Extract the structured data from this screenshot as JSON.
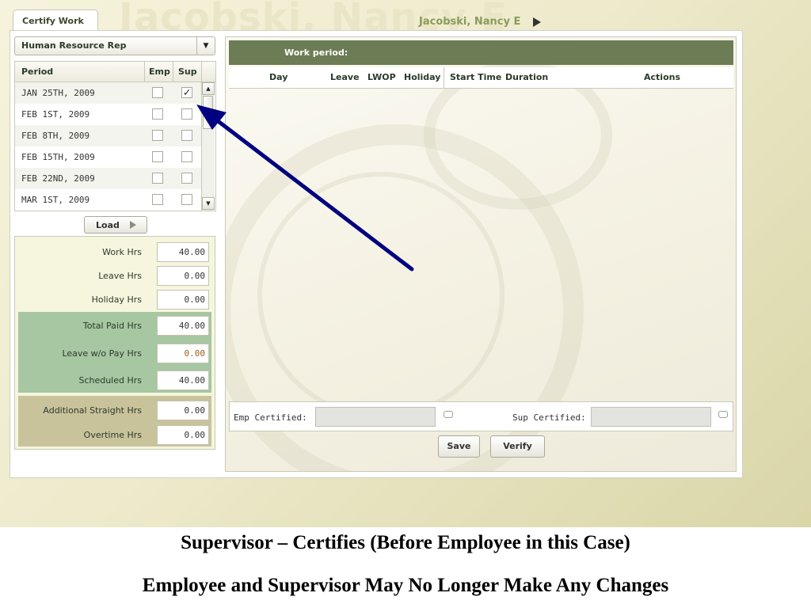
{
  "background_name": "Jacobski, Nancy E",
  "tab": {
    "label": "Certify Work"
  },
  "user": {
    "name": "Jacobski, Nancy E"
  },
  "role_select": {
    "value": "Human Resource Rep"
  },
  "period_grid": {
    "headers": {
      "period": "Period",
      "emp": "Emp",
      "sup": "Sup"
    },
    "rows": [
      {
        "period": "JAN 25TH, 2009",
        "emp": false,
        "sup": true
      },
      {
        "period": "FEB 1ST, 2009",
        "emp": false,
        "sup": false
      },
      {
        "period": "FEB 8TH, 2009",
        "emp": false,
        "sup": false
      },
      {
        "period": "FEB 15TH, 2009",
        "emp": false,
        "sup": false
      },
      {
        "period": "FEB 22ND, 2009",
        "emp": false,
        "sup": false
      },
      {
        "period": "MAR 1ST, 2009",
        "emp": false,
        "sup": false
      }
    ],
    "check_glyph": "✓"
  },
  "load_button": {
    "label": "Load"
  },
  "hours": {
    "work": {
      "label": "Work Hrs",
      "value": "40.00"
    },
    "leave": {
      "label": "Leave Hrs",
      "value": "0.00"
    },
    "holiday": {
      "label": "Holiday Hrs",
      "value": "0.00"
    },
    "total_paid": {
      "label": "Total Paid Hrs",
      "value": "40.00"
    },
    "leave_wo_pay": {
      "label": "Leave w/o Pay Hrs",
      "value": "0.00"
    },
    "scheduled": {
      "label": "Scheduled Hrs",
      "value": "40.00"
    },
    "additional_straight": {
      "label": "Additional Straight Hrs",
      "value": "0.00"
    },
    "overtime": {
      "label": "Overtime Hrs",
      "value": "0.00"
    }
  },
  "work_period": {
    "title": "Work period:",
    "columns": [
      "Day",
      "Leave",
      "LWOP",
      "Holiday",
      "Start Time",
      "Duration",
      "Actions"
    ]
  },
  "certification": {
    "emp_label": "Emp Certified:",
    "sup_label": "Sup Certified:"
  },
  "buttons": {
    "save": "Save",
    "verify": "Verify"
  },
  "captions": {
    "line1": "Supervisor – Certifies (Before Employee in this Case)",
    "line2": "Employee and Supervisor May No Longer Make Any Changes"
  },
  "colors": {
    "header_green": "#6c7c55",
    "arrow_navy": "#000080",
    "green_band": "#a6c7a1",
    "tan_band": "#c8c39b"
  }
}
